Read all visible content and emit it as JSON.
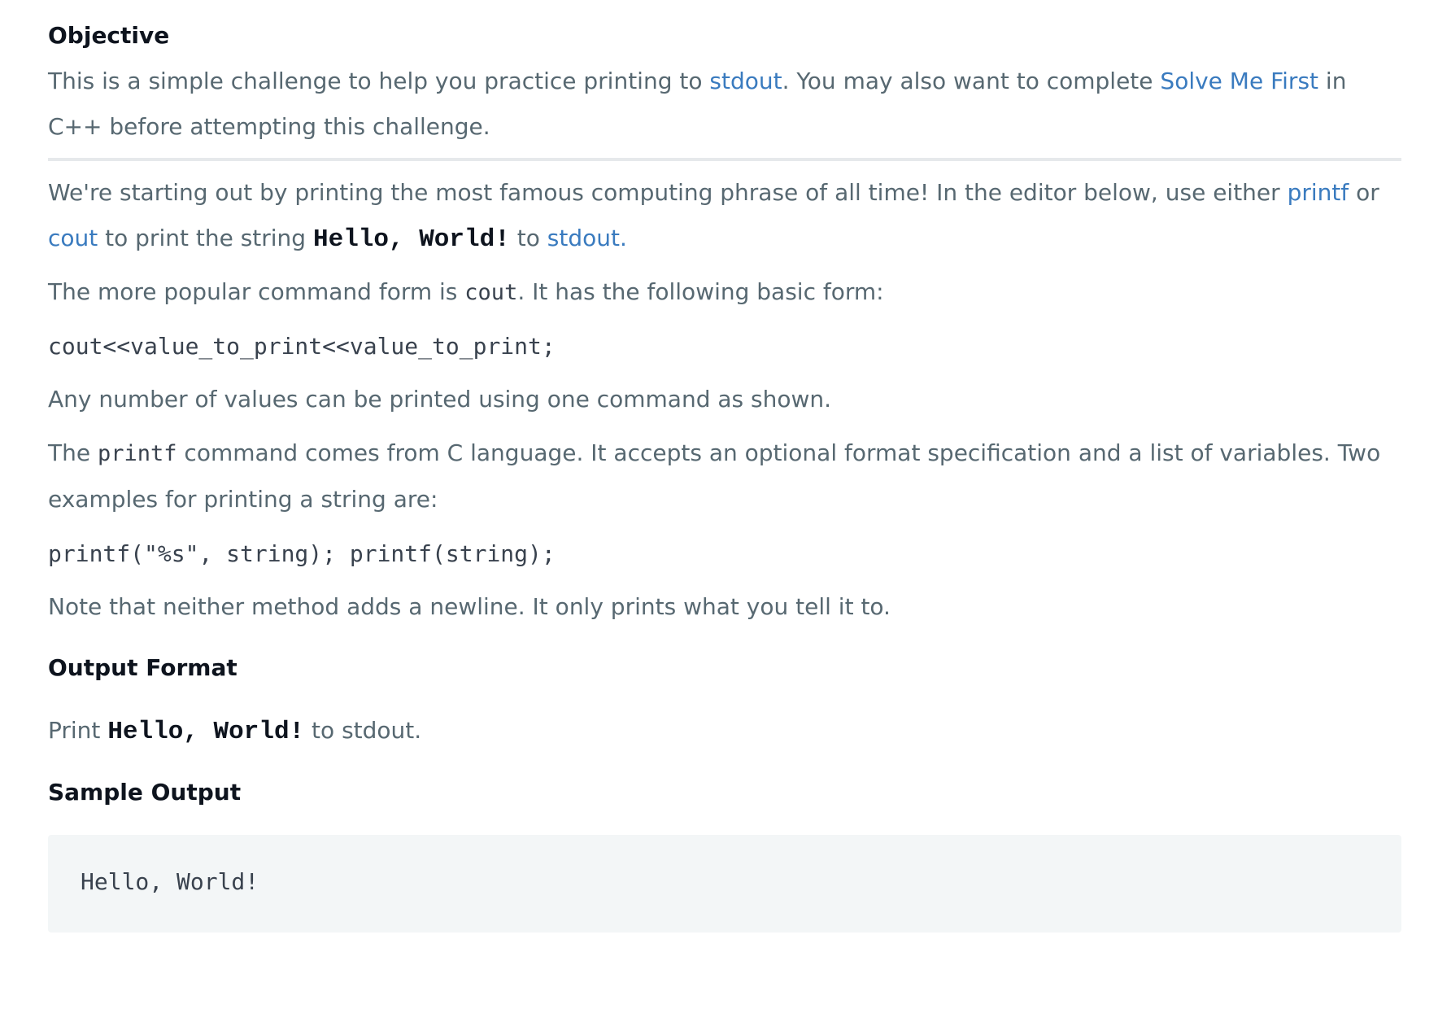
{
  "objective": {
    "heading": "Objective",
    "text_1": "This is a simple challenge to help you practice printing to ",
    "link_stdout": "stdout",
    "text_2": ". You may also want to complete ",
    "link_solve_me_first": "Solve Me First",
    "text_3": " in C++ before attempting this challenge."
  },
  "intro": {
    "text_1": "We're starting out by printing the most famous computing phrase of all time! In the editor below, use either ",
    "link_printf": "printf",
    "text_or": " or ",
    "link_cout": "cout",
    "text_2": " to print the string ",
    "code_hello": "Hello, World!",
    "text_to": " to ",
    "link_stdout": "stdout."
  },
  "cout_para": {
    "text_1": "The more popular command form is ",
    "code": "cout",
    "text_2": ". It has the following basic form:"
  },
  "cout_example": "cout<<value_to_print<<value_to_print;",
  "any_number": "Any number of values can be printed using one command as shown.",
  "printf_para": {
    "text_1": "The ",
    "code": "printf",
    "text_2": " command comes from C language. It accepts an optional format specification and a list of variables. Two examples for printing a string are:"
  },
  "printf_example": "printf(\"%s\", string); printf(string);",
  "note": "Note that neither method adds a newline. It only prints what you tell it to.",
  "output_format": {
    "heading": "Output Format",
    "text_1": "Print ",
    "code": "Hello, World!",
    "text_2": " to stdout."
  },
  "sample_output": {
    "heading": "Sample Output",
    "content": "Hello, World!"
  },
  "colors": {
    "text": "#576871",
    "heading": "#0e141e",
    "link": "#3a7bbf",
    "code_bg": "#f3f6f7",
    "divider": "#e6e9eb"
  }
}
